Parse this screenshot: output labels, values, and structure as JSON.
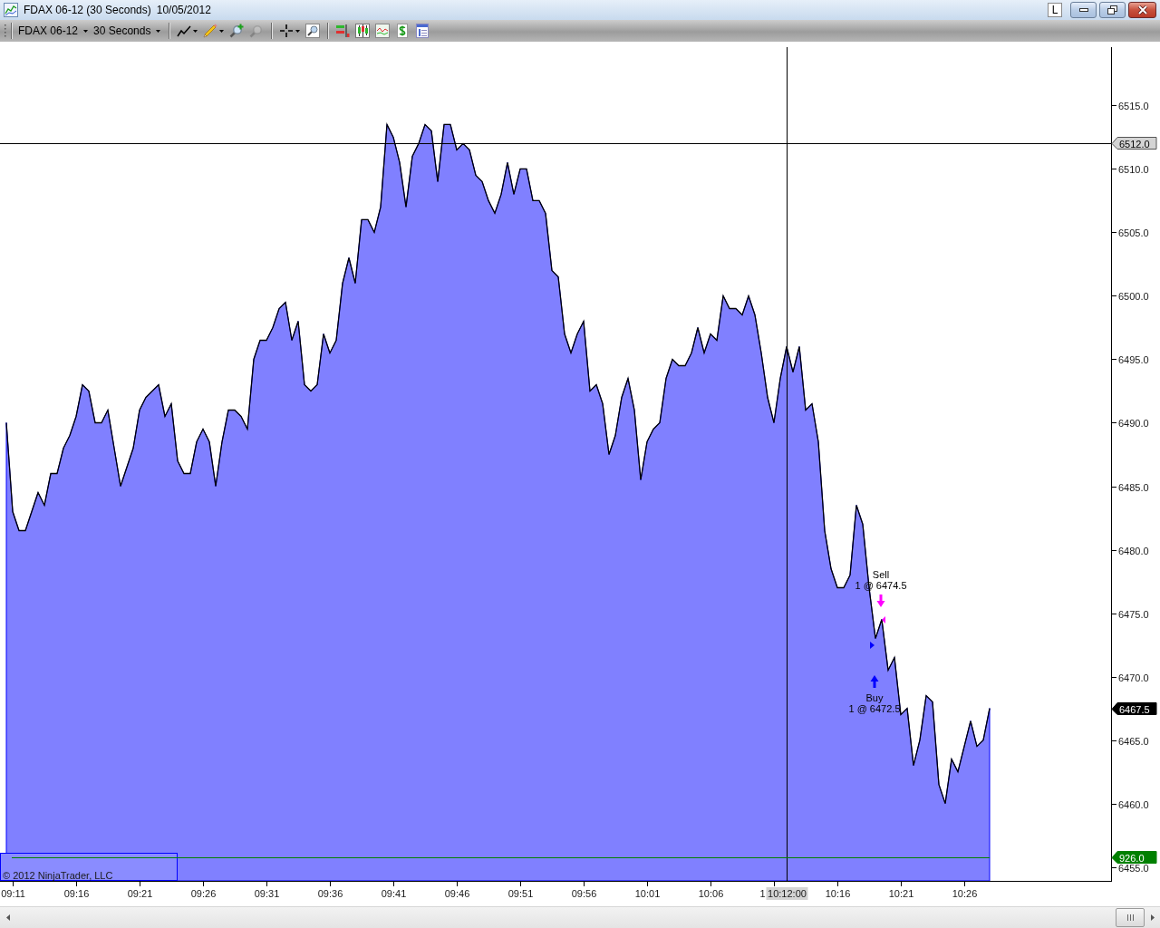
{
  "window": {
    "title": "FDAX 06-12 (30 Seconds)",
    "date": "10/05/2012",
    "link_button": "L"
  },
  "toolbar": {
    "instrument": "FDAX 06-12",
    "interval": "30 Seconds",
    "tool_groups": [
      {
        "tools": [
          {
            "kind": "line",
            "dropdown": true,
            "disabled": false
          },
          {
            "kind": "pencil",
            "dropdown": true,
            "disabled": false
          },
          {
            "kind": "zoom-in",
            "dropdown": false,
            "disabled": false
          },
          {
            "kind": "zoom-out",
            "dropdown": false,
            "disabled": true
          }
        ]
      },
      {
        "tools": [
          {
            "kind": "crosshair",
            "dropdown": true,
            "disabled": false
          },
          {
            "kind": "zoom-frame",
            "dropdown": false,
            "disabled": false
          }
        ]
      },
      {
        "tools": [
          {
            "kind": "indicators",
            "dropdown": false,
            "disabled": false
          },
          {
            "kind": "candlestick",
            "dropdown": false,
            "disabled": false
          },
          {
            "kind": "chart-window",
            "dropdown": false,
            "disabled": false
          },
          {
            "kind": "dollar",
            "dropdown": false,
            "disabled": false
          },
          {
            "kind": "properties",
            "dropdown": false,
            "disabled": false
          }
        ]
      }
    ]
  },
  "chart": {
    "chart_data": {
      "type": "area",
      "x": [
        550.5,
        551,
        551.5,
        552,
        552.5,
        553,
        553.5,
        554,
        554.5,
        555,
        555.5,
        556,
        556.5,
        557,
        557.5,
        558,
        558.5,
        559,
        559.5,
        560,
        560.5,
        561,
        561.5,
        562,
        562.5,
        563,
        563.5,
        564,
        564.5,
        565,
        565.5,
        566,
        566.5,
        567,
        567.5,
        568,
        568.5,
        569,
        569.5,
        570,
        570.5,
        571,
        571.5,
        572,
        572.5,
        573,
        573.5,
        574,
        574.5,
        575,
        575.5,
        576,
        576.5,
        577,
        577.5,
        578,
        578.5,
        579,
        579.5,
        580,
        580.5,
        581,
        581.5,
        582,
        582.5,
        583,
        583.5,
        584,
        584.5,
        585,
        585.5,
        586,
        586.5,
        587,
        587.5,
        588,
        588.5,
        589,
        589.5,
        590,
        590.5,
        591,
        591.5,
        592,
        592.5,
        593,
        593.5,
        594,
        594.5,
        595,
        595.5,
        596,
        596.5,
        597,
        597.5,
        598,
        598.5,
        599,
        599.5,
        600,
        600.5,
        601,
        601.5,
        602,
        602.5,
        603,
        603.5,
        604,
        604.5,
        605,
        605.5,
        606,
        606.5,
        607,
        607.5,
        608,
        608.5,
        609,
        609.5,
        610,
        610.5,
        611,
        611.5,
        612,
        612.5,
        613,
        613.5,
        614,
        614.5,
        615,
        615.5,
        616,
        616.5,
        617,
        617.5,
        618,
        618.5,
        619,
        619.5,
        620,
        620.5,
        621,
        621.5,
        622,
        622.5,
        623,
        623.5,
        624,
        624.5,
        625,
        625.5,
        626,
        626.5,
        627,
        627.5,
        628
      ],
      "series": [
        {
          "color": "#8080ff",
          "values": [
            6490.0,
            6483.0,
            6481.5,
            6481.5,
            6483.0,
            6484.5,
            6483.5,
            6486.0,
            6486.0,
            6488.0,
            6489.0,
            6490.5,
            6493.0,
            6492.5,
            6490.0,
            6490.0,
            6491.0,
            6488.0,
            6485.0,
            6486.5,
            6488.0,
            6491.0,
            6492.0,
            6492.5,
            6493.0,
            6490.5,
            6491.5,
            6487.0,
            6486.0,
            6486.0,
            6488.5,
            6489.5,
            6488.5,
            6485.0,
            6488.5,
            6491.0,
            6491.0,
            6490.5,
            6489.5,
            6495.0,
            6496.5,
            6496.5,
            6497.5,
            6499.0,
            6499.5,
            6496.5,
            6498.0,
            6493.0,
            6492.5,
            6493.0,
            6497.0,
            6495.5,
            6496.5,
            6501.0,
            6503.0,
            6501.0,
            6506.0,
            6506.0,
            6505.0,
            6507.0,
            6513.5,
            6512.5,
            6510.5,
            6507.0,
            6511.0,
            6512.0,
            6513.5,
            6513.0,
            6509.0,
            6513.5,
            6513.5,
            6511.5,
            6512.0,
            6511.5,
            6509.5,
            6509.0,
            6507.5,
            6506.5,
            6508.0,
            6510.5,
            6508.0,
            6510.0,
            6510.0,
            6507.5,
            6507.5,
            6506.5,
            6502.0,
            6501.5,
            6497.0,
            6495.5,
            6497.0,
            6498.0,
            6492.5,
            6493.0,
            6491.5,
            6487.5,
            6489.0,
            6492.0,
            6493.5,
            6491.0,
            6485.5,
            6488.5,
            6489.5,
            6490.0,
            6493.5,
            6495.0,
            6494.5,
            6494.5,
            6495.5,
            6497.5,
            6495.5,
            6497.0,
            6496.5,
            6500.0,
            6499.0,
            6499.0,
            6498.5,
            6500.0,
            6498.5,
            6495.5,
            6492.0,
            6490.0,
            6493.5,
            6496.0,
            6494.0,
            6496.0,
            6491.0,
            6491.5,
            6488.5,
            6481.5,
            6478.5,
            6477.0,
            6477.0,
            6478.0,
            6483.5,
            6482.0,
            6477.0,
            6473.0,
            6474.5,
            6470.5,
            6471.5,
            6467.0,
            6467.5,
            6463.0,
            6465.0,
            6468.5,
            6468.0,
            6461.5,
            6460.0,
            6463.5,
            6462.5,
            6464.5,
            6466.5,
            6464.5,
            6465.0,
            6467.5
          ]
        }
      ],
      "xlim": [
        550,
        637.57
      ],
      "ylim": [
        6453.9,
        6519.6
      ],
      "xticks": [
        {
          "value": 551,
          "label": "09:11"
        },
        {
          "value": 556,
          "label": "09:16"
        },
        {
          "value": 561,
          "label": "09:21"
        },
        {
          "value": 566,
          "label": "09:26"
        },
        {
          "value": 571,
          "label": "09:31"
        },
        {
          "value": 576,
          "label": "09:36"
        },
        {
          "value": 581,
          "label": "09:41"
        },
        {
          "value": 586,
          "label": "09:46"
        },
        {
          "value": 591,
          "label": "09:51"
        },
        {
          "value": 596,
          "label": "09:56"
        },
        {
          "value": 601,
          "label": "10:01"
        },
        {
          "value": 606,
          "label": "10:06"
        },
        {
          "value": 616,
          "label": "10:16"
        },
        {
          "value": 621,
          "label": "10:21"
        },
        {
          "value": 626,
          "label": "10:26"
        }
      ],
      "yticks": [
        {
          "value": 6455,
          "label": "6455.0"
        },
        {
          "value": 6460,
          "label": "6460.0"
        },
        {
          "value": 6465,
          "label": "6465.0"
        },
        {
          "value": 6470,
          "label": "6470.0"
        },
        {
          "value": 6475,
          "label": "6475.0"
        },
        {
          "value": 6480,
          "label": "6480.0"
        },
        {
          "value": 6485,
          "label": "6485.0"
        },
        {
          "value": 6490,
          "label": "6490.0"
        },
        {
          "value": 6495,
          "label": "6495.0"
        },
        {
          "value": 6500,
          "label": "6500.0"
        },
        {
          "value": 6505,
          "label": "6505.0"
        },
        {
          "value": 6510,
          "label": "6510.0"
        },
        {
          "value": 6515,
          "label": "6515.0"
        }
      ],
      "ref_lines": [
        {
          "axis": "y",
          "value": 6512,
          "label": "6512.0"
        },
        {
          "axis": "x",
          "value": 612
        }
      ]
    },
    "crosshair_time": "10:12:00",
    "covered_tick_label": "1",
    "last_price": "6467.5",
    "indicator": "926.0",
    "trades": [
      {
        "kind": "sell",
        "title": "Sell",
        "detail": "1 @ 6474.5",
        "color": "#ff00ff"
      },
      {
        "kind": "buy",
        "title": "Buy",
        "detail": "1 @ 6472.5",
        "color": "#0000ff"
      }
    ],
    "copyright": "© 2012 NinjaTrader, LLC"
  }
}
